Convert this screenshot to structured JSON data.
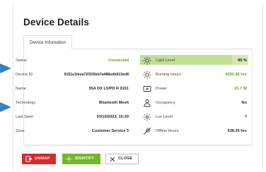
{
  "dialog": {
    "title": "Device Details",
    "tab_label": "Device Infomation"
  },
  "details": [
    {
      "label": "Status",
      "value": "Connected"
    },
    {
      "label": "Device ID",
      "value": "9151e1feea72f325bb7a488edb913ed8"
    },
    {
      "label": "Name",
      "value": "55A DX L5/PD R 9151"
    },
    {
      "label": "Technology",
      "value": "Bluetooth Mesh"
    },
    {
      "label": "Last Seen",
      "value": "03/10/2023, 15:29"
    },
    {
      "label": "Zone",
      "value": "Customer Service 3"
    }
  ],
  "metrics": [
    {
      "icon": "light-level-icon",
      "label": "Light Level",
      "value": "85 %",
      "level_percent": 85
    },
    {
      "icon": "burning-hours-icon",
      "label": "Burning Hours",
      "value": "4251.45 hrs"
    },
    {
      "icon": "power-icon",
      "label": "Power",
      "value": "21.7 W"
    },
    {
      "icon": "occupancy-icon",
      "label": "Occupancy",
      "value": "No"
    },
    {
      "icon": "lux-level-icon",
      "label": "Lux Level",
      "value": "?"
    },
    {
      "icon": "offline-hours-icon",
      "label": "Offline Hours",
      "value": "538.35 hrs"
    }
  ],
  "buttons": {
    "unmap": "UNMAP",
    "identify": "IDENTIFY",
    "close": "CLOSE"
  },
  "colors": {
    "accent_green": "#74b726",
    "danger_red": "#d52b2b",
    "status_green": "#5a9e12",
    "highlight": "#d5e8b3"
  }
}
